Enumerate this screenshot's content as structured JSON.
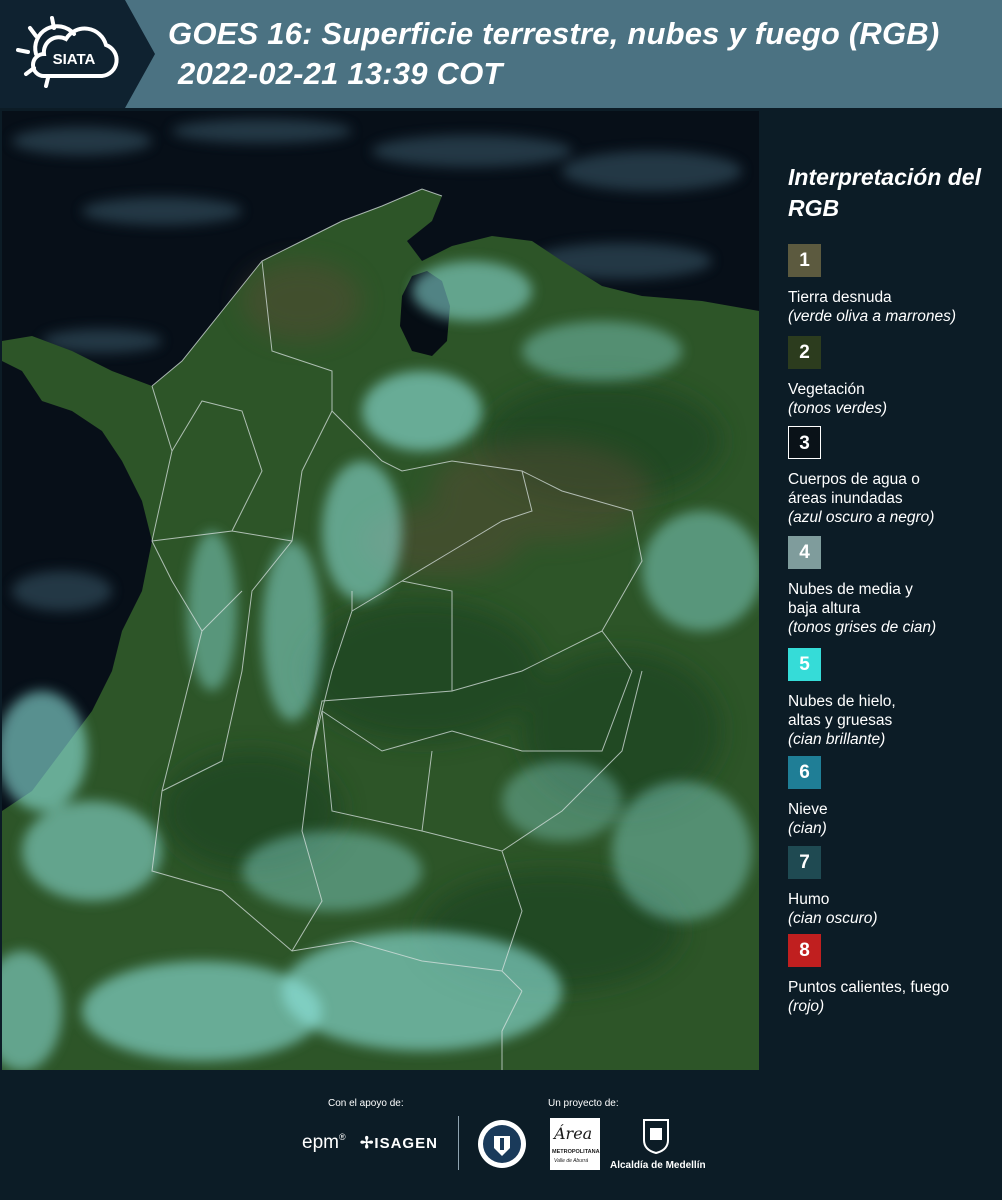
{
  "header": {
    "brand": "SIATA",
    "title_line1": "GOES 16: Superficie terrestre, nubes y fuego (RGB)",
    "title_line2": "2022-02-21 13:39 COT"
  },
  "legend": {
    "title": "Interpretación del RGB",
    "items": [
      {
        "num": "1",
        "color": "#5c5a3f",
        "label": "Tierra desnuda",
        "desc": "(verde oliva a marrones)"
      },
      {
        "num": "2",
        "color": "#2c3c1e",
        "label": "Vegetación",
        "desc": "(tonos verdes)"
      },
      {
        "num": "3",
        "color": "#0a1218",
        "label": "Cuerpos de agua o áreas inundadas",
        "desc": "(azul oscuro a negro)"
      },
      {
        "num": "4",
        "color": "#7f9c9c",
        "label": "Nubes de media y baja altura",
        "desc": "(tonos grises de cian)"
      },
      {
        "num": "5",
        "color": "#35dcd8",
        "label": "Nubes de hielo, altas y gruesas",
        "desc": "(cian brillante)"
      },
      {
        "num": "6",
        "color": "#1f7e96",
        "label": "Nieve",
        "desc": "(cian)"
      },
      {
        "num": "7",
        "color": "#1f4a52",
        "label": "Humo",
        "desc": "(cian oscuro)"
      },
      {
        "num": "8",
        "color": "#c01f1f",
        "label": "Puntos calientes, fuego",
        "desc": "(rojo)"
      }
    ]
  },
  "footer": {
    "support_caption": "Con el apoyo de:",
    "project_caption": "Un proyecto de:",
    "logos": {
      "epm": "epm",
      "isagen": "ISAGEN",
      "area_name": "Área",
      "area_sub": "METROPOLITANA",
      "area_sub2": "Valle de Aburrá",
      "alcaldia": "Alcaldía de Medellín"
    }
  },
  "colors": {
    "header_bg": "#4b7282",
    "panel_bg": "#0c1c26",
    "land": "#2e5a2a",
    "cloud": "#8fe6e0",
    "ocean": "#06101a"
  }
}
